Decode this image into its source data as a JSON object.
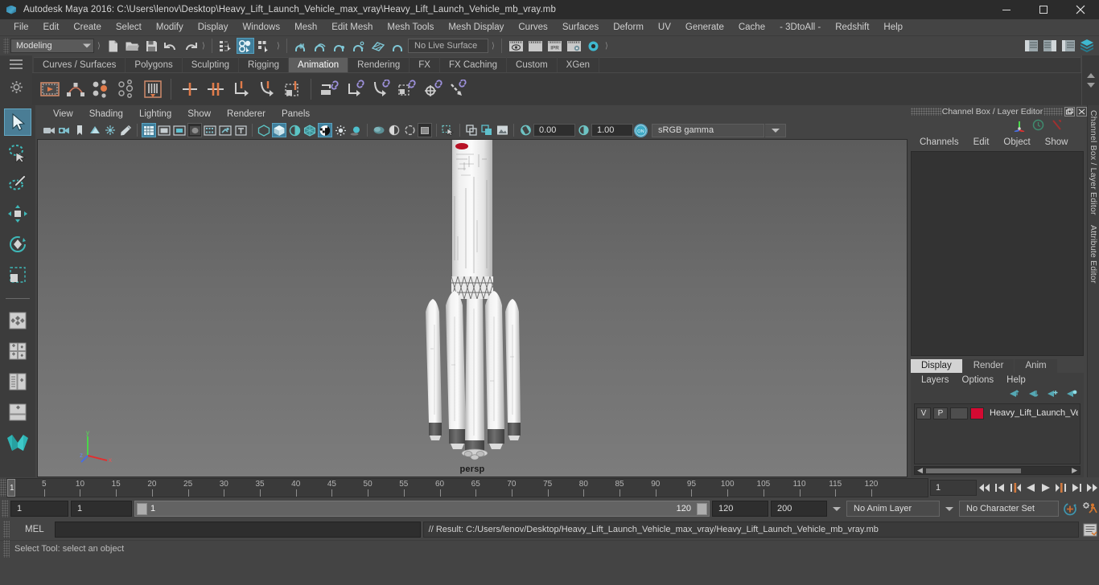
{
  "window": {
    "title": "Autodesk Maya 2016: C:\\Users\\lenov\\Desktop\\Heavy_Lift_Launch_Vehicle_max_vray\\Heavy_Lift_Launch_Vehicle_mb_vray.mb",
    "minimize": "–",
    "maximize": "❐",
    "close": "✕"
  },
  "menubar": {
    "items": [
      {
        "label": "File"
      },
      {
        "label": "Edit"
      },
      {
        "label": "Create"
      },
      {
        "label": "Select"
      },
      {
        "label": "Modify"
      },
      {
        "label": "Display"
      },
      {
        "label": "Windows"
      },
      {
        "label": "Mesh"
      },
      {
        "label": "Edit Mesh"
      },
      {
        "label": "Mesh Tools"
      },
      {
        "label": "Mesh Display"
      },
      {
        "label": "Curves"
      },
      {
        "label": "Surfaces"
      },
      {
        "label": "Deform"
      },
      {
        "label": "UV"
      },
      {
        "label": "Generate"
      },
      {
        "label": "Cache"
      },
      {
        "label": "- 3DtoAll -"
      },
      {
        "label": "Redshift"
      },
      {
        "label": "Help"
      }
    ]
  },
  "statusbar": {
    "menu_set": "Modeling",
    "live_surface": "No Live Surface"
  },
  "shelf": {
    "tabs": [
      {
        "label": "Curves / Surfaces",
        "active": false
      },
      {
        "label": "Polygons",
        "active": false
      },
      {
        "label": "Sculpting",
        "active": false
      },
      {
        "label": "Rigging",
        "active": false
      },
      {
        "label": "Animation",
        "active": true
      },
      {
        "label": "Rendering",
        "active": false
      },
      {
        "label": "FX",
        "active": false
      },
      {
        "label": "FX Caching",
        "active": false
      },
      {
        "label": "Custom",
        "active": false
      },
      {
        "label": "XGen",
        "active": false
      }
    ]
  },
  "viewport": {
    "menus": [
      {
        "label": "View"
      },
      {
        "label": "Shading"
      },
      {
        "label": "Lighting"
      },
      {
        "label": "Show"
      },
      {
        "label": "Renderer"
      },
      {
        "label": "Panels"
      }
    ],
    "exposure_value": "0.00",
    "gamma_value": "1.00",
    "color_management": "sRGB gamma",
    "camera_label": "persp",
    "axis_y_label": "y",
    "axis_x_label": "x",
    "axis_z_label": "z"
  },
  "channel_box": {
    "panel_title": "Channel Box / Layer Editor",
    "menus": [
      {
        "label": "Channels"
      },
      {
        "label": "Edit"
      },
      {
        "label": "Object"
      },
      {
        "label": "Show"
      }
    ],
    "undock_label": "❐",
    "close_label": "✕",
    "side_tabs": [
      "Channel Box / Layer Editor",
      "Attribute Editor"
    ]
  },
  "layer_editor": {
    "tabs": [
      {
        "label": "Display",
        "active": true
      },
      {
        "label": "Render",
        "active": false
      },
      {
        "label": "Anim",
        "active": false
      }
    ],
    "menus": [
      {
        "label": "Layers"
      },
      {
        "label": "Options"
      },
      {
        "label": "Help"
      }
    ],
    "layers": [
      {
        "visibility": "V",
        "playback": "P",
        "shading": "",
        "color": "#d40a32",
        "name": "Heavy_Lift_Launch_Veh"
      }
    ]
  },
  "timeline": {
    "start": 1,
    "end": 120,
    "current_frame": "1",
    "current_frame_field": "1",
    "tick_labels": [
      5,
      10,
      15,
      20,
      25,
      30,
      35,
      40,
      45,
      50,
      55,
      60,
      65,
      70,
      75,
      80,
      85,
      90,
      95,
      100,
      105,
      110,
      115,
      120
    ]
  },
  "playback": {
    "buttons": [
      {
        "name": "go-to-start",
        "glyph": "start"
      },
      {
        "name": "step-back-frame",
        "glyph": "prev"
      },
      {
        "name": "step-back-key",
        "glyph": "prevkey"
      },
      {
        "name": "play-backwards",
        "glyph": "playback"
      },
      {
        "name": "play-forwards",
        "glyph": "playfwd"
      },
      {
        "name": "step-forward-key",
        "glyph": "nextkey"
      },
      {
        "name": "step-forward-frame",
        "glyph": "next"
      },
      {
        "name": "go-to-end",
        "glyph": "end"
      }
    ]
  },
  "range_slider": {
    "anim_start": "1",
    "playback_start": "1",
    "range_left_label": "1",
    "range_right_label": "120",
    "playback_end": "120",
    "anim_end": "200",
    "anim_layer": "No Anim Layer",
    "character_set": "No Character Set"
  },
  "command_line": {
    "language": "MEL",
    "input_value": "",
    "result": "// Result: C:/Users/lenov/Desktop/Heavy_Lift_Launch_Vehicle_max_vray/Heavy_Lift_Launch_Vehicle_mb_vray.mb"
  },
  "status_line": {
    "help_text": "Select Tool: select an object"
  }
}
